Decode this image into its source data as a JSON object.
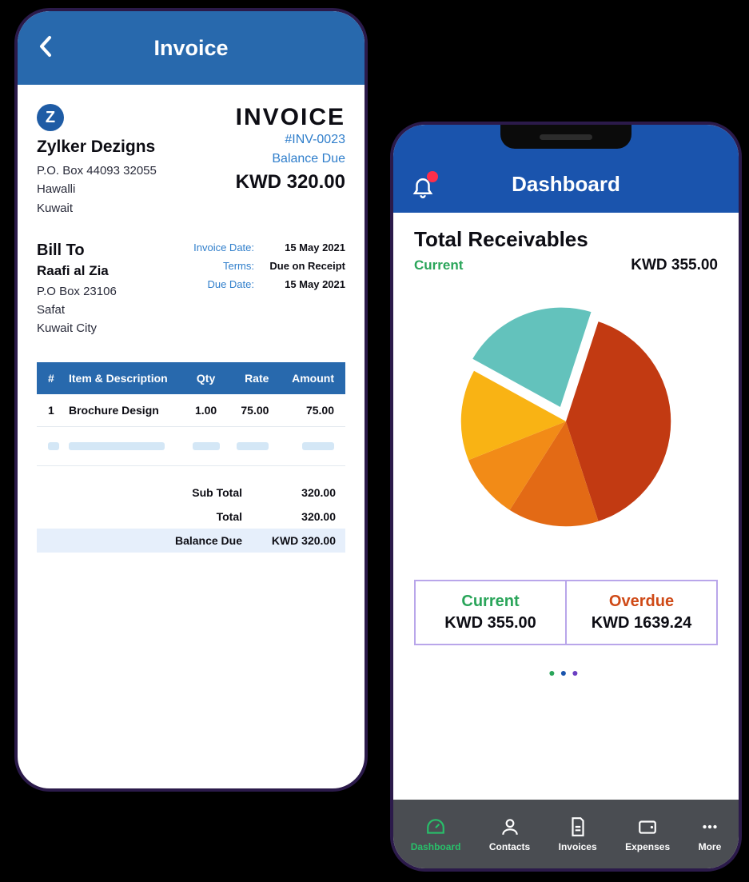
{
  "phone1": {
    "header_title": "Invoice",
    "logo_letter": "Z",
    "doc_title": "INVOICE",
    "doc_num": "#INV-0023",
    "from": {
      "name": "Zylker Dezigns",
      "line1": "P.O. Box 44093 32055",
      "line2": "Hawalli",
      "line3": "Kuwait"
    },
    "balance_due_label": "Balance Due",
    "balance_due_amount": "KWD 320.00",
    "billto_title": "Bill To",
    "billto": {
      "name": "Raafi al Zia",
      "line1": "P.O Box 23106",
      "line2": "Safat",
      "line3": "Kuwait City"
    },
    "meta": {
      "invoice_date_k": "Invoice Date:",
      "invoice_date_v": "15 May 2021",
      "terms_k": "Terms:",
      "terms_v": "Due on Receipt",
      "due_date_k": "Due Date:",
      "due_date_v": "15 May 2021"
    },
    "cols": {
      "num": "#",
      "item": "Item & Description",
      "qty": "Qty",
      "rate": "Rate",
      "amount": "Amount"
    },
    "row1": {
      "num": "1",
      "item": "Brochure Design",
      "qty": "1.00",
      "rate": "75.00",
      "amount": "75.00"
    },
    "totals": {
      "subtotal_k": "Sub Total",
      "subtotal_v": "320.00",
      "total_k": "Total",
      "total_v": "320.00",
      "due_k": "Balance Due",
      "due_v": "KWD 320.00"
    }
  },
  "phone2": {
    "header_title": "Dashboard",
    "title": "Total Receivables",
    "current_label": "Current",
    "current_amount": "KWD 355.00",
    "legend": {
      "current_k": "Current",
      "current_v": "KWD 355.00",
      "overdue_k": "Overdue",
      "overdue_v": "KWD 1639.24"
    },
    "tabs": {
      "dashboard": "Dashboard",
      "contacts": "Contacts",
      "invoices": "Invoices",
      "expenses": "Expenses",
      "more": "More"
    }
  },
  "chart_data": {
    "type": "pie",
    "title": "Total Receivables",
    "slices": [
      {
        "name": "Segment 1",
        "value": 40,
        "color": "#c23a12"
      },
      {
        "name": "Segment 2",
        "value": 14,
        "color": "#e36a15"
      },
      {
        "name": "Segment 3",
        "value": 10,
        "color": "#f28b17"
      },
      {
        "name": "Segment 4",
        "value": 14,
        "color": "#f9b314"
      },
      {
        "name": "Segment 5 (exploded)",
        "value": 22,
        "color": "#63c2bc",
        "explode": true
      }
    ]
  }
}
